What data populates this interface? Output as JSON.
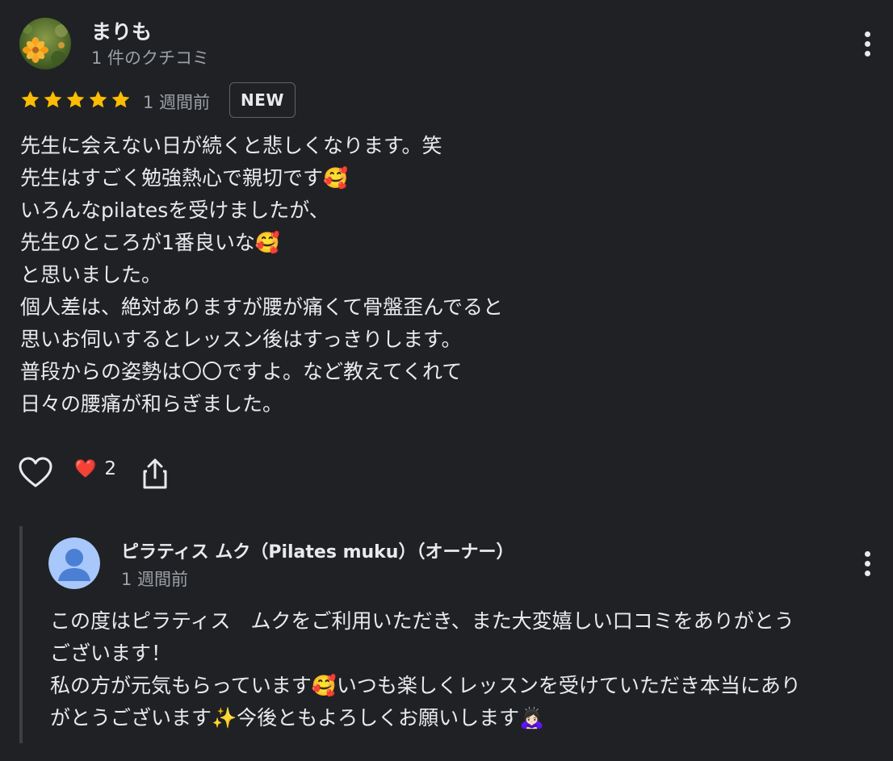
{
  "review": {
    "reviewer_name": "まりも",
    "reviewer_info": "1 件のクチコミ",
    "rating": 5,
    "time": "1 週間前",
    "badge": "NEW",
    "lines": [
      "先生に会えない日が続くと悲しくなります。笑",
      "先生はすごく勉強熱心で親切です🥰",
      "いろんなpilatesを受けましたが、",
      "先生のところが1番良いな🥰",
      "と思いました。",
      "個人差は、絶対ありますが腰が痛くて骨盤歪んでると",
      "思いお伺いするとレッスン後はすっきりします。",
      "普段からの姿勢は〇〇ですよ。など教えてくれて",
      "日々の腰痛が和らぎました。"
    ],
    "reaction_icon": "❤️",
    "reaction_count": "2"
  },
  "reply": {
    "owner_name": "ピラティス ムク（Pilates muku）（オーナー）",
    "time": "1 週間前",
    "lines": [
      "この度はピラティス　ムクをご利用いただき、また大変嬉しい口コミをありがとう",
      "ございます！",
      "私の方が元気もらっています🥰いつも楽しくレッスンを受けていただき本当にあり",
      "がとうございます✨今後ともよろしくお願いします🙇🏻‍♀️"
    ]
  },
  "colors": {
    "background": "#202124",
    "text": "#e8eaed",
    "secondary_text": "#9aa0a6",
    "star": "#fbbc04",
    "heart": "#ea4335"
  },
  "icons": {
    "star": "star-icon",
    "like": "heart-outline-icon",
    "share": "share-icon",
    "more": "more-vertical-icon",
    "owner_avatar": "default-person-icon"
  }
}
